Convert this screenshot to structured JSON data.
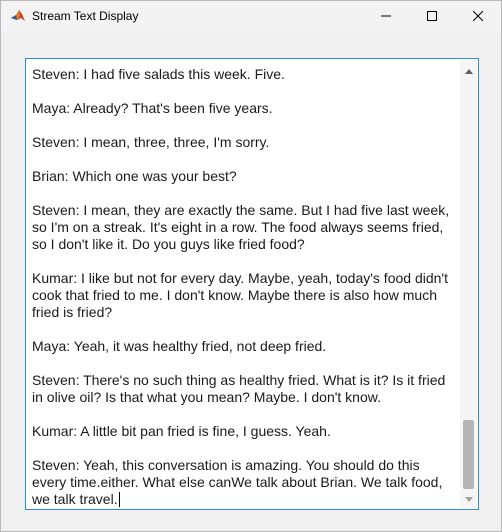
{
  "window": {
    "title": "Stream Text Display",
    "app_icon": "matlab-icon",
    "controls": [
      "minimize-icon",
      "maximize-icon",
      "close-icon"
    ]
  },
  "textarea": {
    "lines": [
      "Steven: I had five salads this week. Five.",
      "Maya: Already? That's been five years.",
      "Steven: I mean, three, three, I'm sorry.",
      "Brian: Which one was your best?",
      "Steven: I mean, they are exactly the same. But I had five last week, so I'm on a streak. It's eight in a row. The food always seems fried, so I don't like it. Do you guys like fried food?",
      "Kumar: I like but not for every day. Maybe, yeah, today's food didn't cook that fried to me. I don't know. Maybe there is also how much fried is fried?",
      "Maya: Yeah, it was healthy fried, not deep fried.",
      "Steven: There's no such thing as healthy fried. What is it? Is it fried in olive oil? Is that what you mean? Maybe. I don't know.",
      "Kumar: A little bit pan fried is fine, I guess. Yeah.",
      "Steven: Yeah, this conversation is amazing. You should do this every time.either. What else canWe talk about Brian. We talk food, we talk travel."
    ],
    "scroll_position": 0.88
  }
}
